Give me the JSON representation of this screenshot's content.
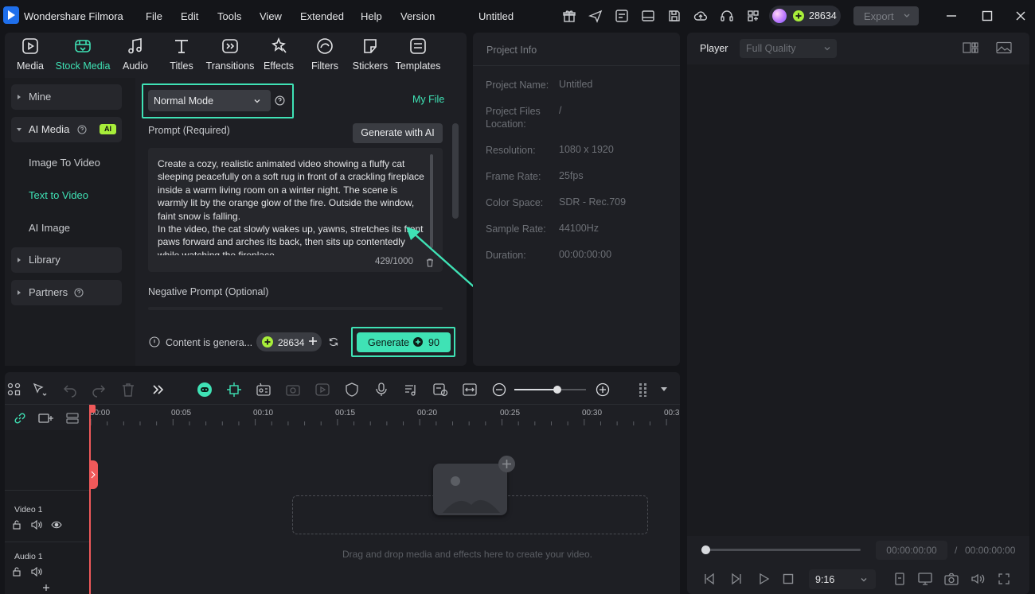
{
  "app": {
    "name": "Wondershare Filmora",
    "project_title": "Untitled",
    "credits": "28634",
    "export_label": "Export"
  },
  "menu": [
    "File",
    "Edit",
    "Tools",
    "View",
    "Extended",
    "Help",
    "Version"
  ],
  "media_tabs": [
    {
      "label": "Media",
      "icon": "media-icon"
    },
    {
      "label": "Stock Media",
      "icon": "stock-media-icon",
      "active": true
    },
    {
      "label": "Audio",
      "icon": "audio-icon"
    },
    {
      "label": "Titles",
      "icon": "titles-icon"
    },
    {
      "label": "Transitions",
      "icon": "transitions-icon"
    },
    {
      "label": "Effects",
      "icon": "effects-icon"
    },
    {
      "label": "Filters",
      "icon": "filters-icon"
    },
    {
      "label": "Stickers",
      "icon": "stickers-icon"
    },
    {
      "label": "Templates",
      "icon": "templates-icon"
    }
  ],
  "sidebar": {
    "mine": "Mine",
    "ai_media": "AI Media",
    "ai_badge": "AI",
    "sub_items": [
      "Image To Video",
      "Text to Video",
      "AI Image"
    ],
    "library": "Library",
    "partners": "Partners"
  },
  "ai_panel": {
    "mode": "Normal Mode",
    "my_file": "My File",
    "prompt_label": "Prompt (Required)",
    "generate_with_ai": "Generate with AI",
    "prompt_text": "Create a cozy, realistic animated video showing a fluffy cat sleeping peacefully on a soft rug in front of a crackling fireplace inside a warm living room on a winter night. The scene is warmly lit by the orange glow of the fire. Outside the window, faint snow is falling.\nIn the video, the cat slowly wakes up, yawns, stretches its front paws forward and arches its back, then sits up contentedly while watching the fireplace.",
    "char_count": "429/1000",
    "negative_label": "Negative Prompt (Optional)",
    "disclaimer": "Content is genera...",
    "credits": "28634",
    "generate_label": "Generate",
    "generate_cost": "90"
  },
  "project_info": {
    "title": "Project Info",
    "rows": [
      {
        "label": "Project Name:",
        "value": "Untitled"
      },
      {
        "label": "Project Files Location:",
        "value": "/"
      },
      {
        "label": "Resolution:",
        "value": "1080 x 1920"
      },
      {
        "label": "Frame Rate:",
        "value": "25fps"
      },
      {
        "label": "Color Space:",
        "value": "SDR - Rec.709"
      },
      {
        "label": "Sample Rate:",
        "value": "44100Hz"
      },
      {
        "label": "Duration:",
        "value": "00:00:00:00"
      }
    ]
  },
  "player": {
    "title": "Player",
    "quality": "Full Quality",
    "current_time": "00:00:00:00",
    "separator": "/",
    "total_time": "00:00:00:00",
    "aspect": "9:16",
    "progress": 0
  },
  "timeline": {
    "ticks": [
      "00:00",
      "00:05",
      "00:10",
      "00:15",
      "00:20",
      "00:25",
      "00:30",
      "00:3"
    ],
    "tracks": [
      {
        "name": "Video 1"
      },
      {
        "name": "Audio 1"
      }
    ],
    "drop_hint": "Drag and drop media and effects here to create your video.",
    "zoom_level": 0.6
  },
  "colors": {
    "accent": "#3fe2b5",
    "panel": "#1e1f24",
    "bg": "#141519",
    "playhead": "#f0595a",
    "credit_green": "#a8ee3a"
  }
}
